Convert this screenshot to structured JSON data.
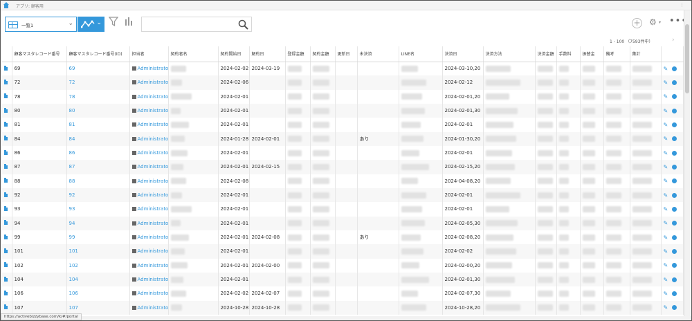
{
  "app": {
    "title": "アプリ: 顧客用"
  },
  "toolbar": {
    "view_name": "一覧1",
    "search_placeholder": ""
  },
  "pager": {
    "range_text": "1 - 100 （7593件中）"
  },
  "table": {
    "headers": [
      "顧客マスタレコード番号",
      "顧客マスタレコード番号(ID)",
      "担当者",
      "契約者名",
      "契約開始日",
      "解約日",
      "登録金額",
      "契約金額",
      "更新日",
      "未決済",
      "LINE名",
      "決済日",
      "決済方法",
      "決済金額",
      "手数料",
      "振替金",
      "備考",
      "集計"
    ],
    "rows": [
      {
        "no": "69",
        "id": "69",
        "user": "Administrator",
        "start": "2024-02-02",
        "cancel": "2024-03-19",
        "unpaid": "",
        "pay_date": "2024-03-10,20"
      },
      {
        "no": "72",
        "id": "72",
        "user": "Administrator",
        "start": "2024-02-06",
        "cancel": "",
        "unpaid": "",
        "pay_date": "2024-02-12"
      },
      {
        "no": "78",
        "id": "78",
        "user": "Administrator",
        "start": "2024-02-01",
        "cancel": "",
        "unpaid": "",
        "pay_date": "2024-02-01,20"
      },
      {
        "no": "80",
        "id": "80",
        "user": "Administrator",
        "start": "2024-02-01",
        "cancel": "",
        "unpaid": "",
        "pay_date": "2024-02-01,30"
      },
      {
        "no": "81",
        "id": "81",
        "user": "Administrator",
        "start": "2024-02-01",
        "cancel": "",
        "unpaid": "",
        "pay_date": "2024-02-01"
      },
      {
        "no": "84",
        "id": "84",
        "user": "Administrator",
        "start": "2024-01-28",
        "cancel": "2024-02-01",
        "unpaid": "あり",
        "pay_date": "2024-01-30,20"
      },
      {
        "no": "86",
        "id": "86",
        "user": "Administrator",
        "start": "2024-02-01",
        "cancel": "",
        "unpaid": "",
        "pay_date": "2024-02-01"
      },
      {
        "no": "87",
        "id": "87",
        "user": "Administrator",
        "start": "2024-02-01",
        "cancel": "2024-02-15",
        "unpaid": "",
        "pay_date": "2024-02-15,20"
      },
      {
        "no": "88",
        "id": "88",
        "user": "Administrator",
        "start": "2024-02-08",
        "cancel": "",
        "unpaid": "",
        "pay_date": "2024-04-08,20"
      },
      {
        "no": "92",
        "id": "92",
        "user": "Administrator",
        "start": "2024-02-01",
        "cancel": "",
        "unpaid": "",
        "pay_date": "2024-02-01"
      },
      {
        "no": "93",
        "id": "93",
        "user": "Administrator",
        "start": "2024-02-01",
        "cancel": "",
        "unpaid": "",
        "pay_date": "2024-02-01"
      },
      {
        "no": "94",
        "id": "94",
        "user": "Administrator",
        "start": "2024-02-01",
        "cancel": "",
        "unpaid": "",
        "pay_date": "2024-02-05,30"
      },
      {
        "no": "99",
        "id": "99",
        "user": "Administrator",
        "start": "2024-02-01",
        "cancel": "2024-02-08",
        "unpaid": "あり",
        "pay_date": "2024-02-08,20"
      },
      {
        "no": "101",
        "id": "101",
        "user": "Administrator",
        "start": "2024-02-01",
        "cancel": "",
        "unpaid": "",
        "pay_date": "2024-02-02"
      },
      {
        "no": "102",
        "id": "102",
        "user": "Administrator",
        "start": "2024-02-01",
        "cancel": "2024-02-00",
        "unpaid": "",
        "pay_date": "2024-02-00,20"
      },
      {
        "no": "104",
        "id": "104",
        "user": "Administrator",
        "start": "2024-02-01",
        "cancel": "",
        "unpaid": "",
        "pay_date": "2024-02-01,30"
      },
      {
        "no": "106",
        "id": "106",
        "user": "Administrator",
        "start": "2024-02-02",
        "cancel": "2024-02-07",
        "unpaid": "",
        "pay_date": "2024-02-07,30"
      },
      {
        "no": "107",
        "id": "107",
        "user": "Administrator",
        "start": "2024-10-28",
        "cancel": "2024-10-28",
        "unpaid": "",
        "pay_date": "2024-10-28,20"
      }
    ]
  },
  "status_url": "https://activebizzybase.com/k/#/portal",
  "colors": {
    "accent": "#3498db"
  }
}
